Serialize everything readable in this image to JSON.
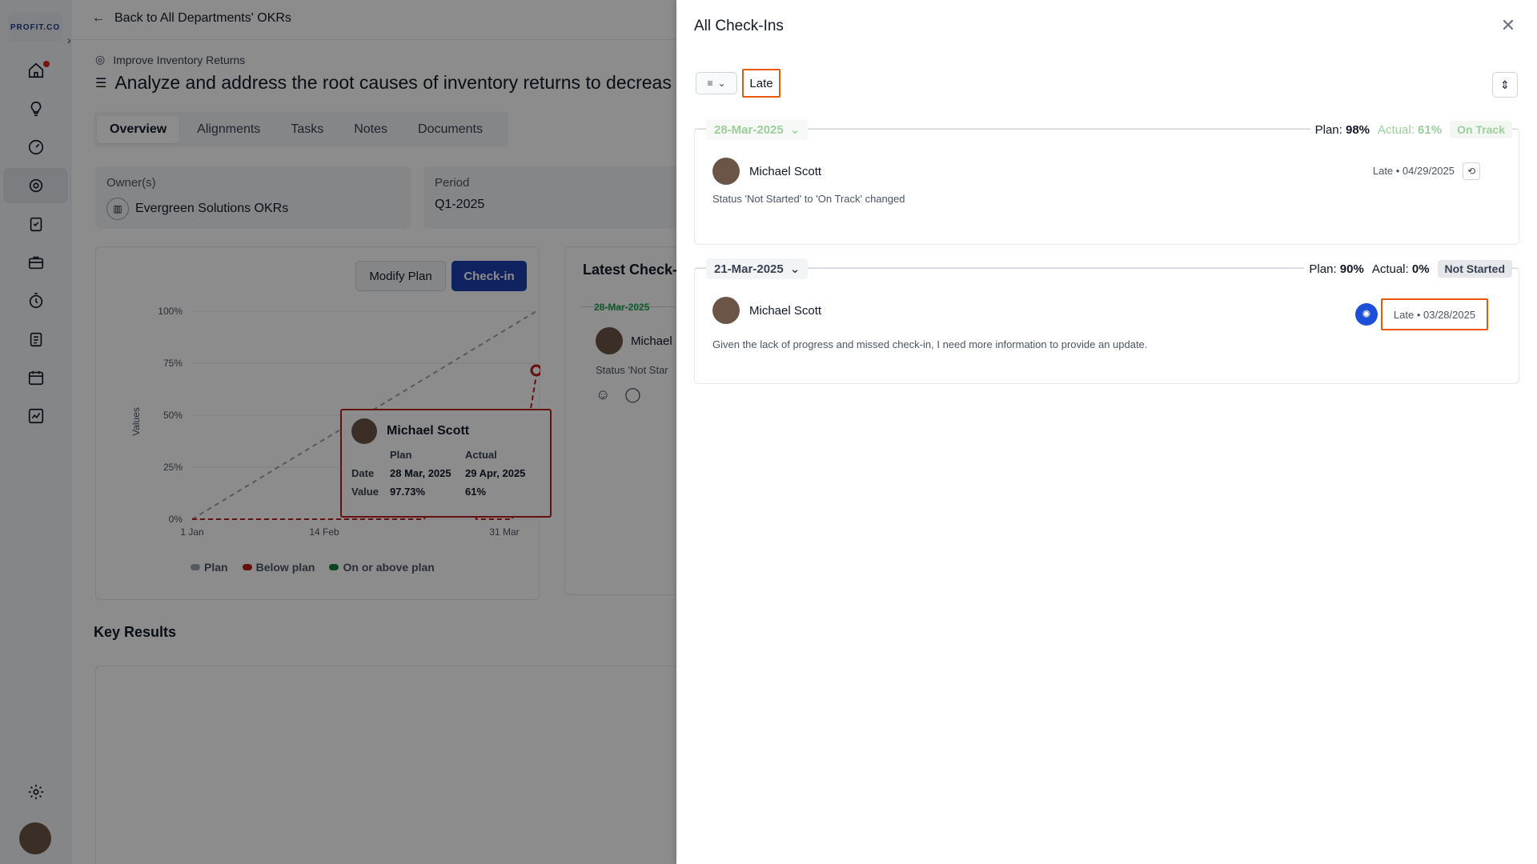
{
  "app": {
    "logo_text": "PROFIT.CO"
  },
  "main": {
    "back_label": "Back to All Departments' OKRs",
    "breadcrumb": "Improve Inventory Returns",
    "title": "Analyze and address the root causes of inventory returns to decreas",
    "tabs": [
      {
        "label": "Overview"
      },
      {
        "label": "Alignments"
      },
      {
        "label": "Tasks"
      },
      {
        "label": "Notes"
      },
      {
        "label": "Documents"
      }
    ],
    "owner_label": "Owner(s)",
    "owner_value": "Evergreen Solutions OKRs",
    "period_label": "Period",
    "period_value": "Q1-2025",
    "modify_plan_label": "Modify Plan",
    "checkin_label": "Check-in",
    "key_results_label": "Key Results",
    "latest": {
      "title": "Latest Check-",
      "date": "28-Mar-2025",
      "user": "Michael",
      "status": "Status 'Not Star"
    }
  },
  "chart_data": {
    "type": "line",
    "ylabel": "Values",
    "y_ticks": [
      "100%",
      "75%",
      "50%",
      "25%",
      "0%"
    ],
    "x_ticks": [
      "1 Jan",
      "14 Feb",
      "31 Mar"
    ],
    "ylim": [
      0,
      100
    ],
    "series": [
      {
        "name": "Plan",
        "color": "#9ca3af"
      },
      {
        "name": "Below plan",
        "color": "#b91c1c"
      },
      {
        "name": "On or above plan",
        "color": "#15803d"
      }
    ],
    "tooltip": {
      "user": "Michael Scott",
      "col_plan": "Plan",
      "col_actual": "Actual",
      "row_date": "Date",
      "row_value": "Value",
      "plan_date": "28 Mar, 2025",
      "actual_date": "29 Apr, 2025",
      "plan_value": "97.73%",
      "actual_value": "61%"
    }
  },
  "drawer": {
    "title": "All Check-Ins",
    "filter_chip": "Late",
    "entries": [
      {
        "date": "28-Mar-2025",
        "plan_label": "Plan:",
        "plan_value": "98%",
        "actual_label": "Actual:",
        "actual_value": "61%",
        "status": "On Track",
        "user": "Michael Scott",
        "late_text": "Late • 04/29/2025",
        "text": "Status 'Not Started' to 'On Track' changed"
      },
      {
        "date": "21-Mar-2025",
        "plan_label": "Plan:",
        "plan_value": "90%",
        "actual_label": "Actual:",
        "actual_value": "0%",
        "status": "Not Started",
        "user": "Michael Scott",
        "late_text": "Late • 03/28/2025",
        "text": "Given the lack of progress and missed check-in, I need more information to provide an update."
      }
    ]
  },
  "colors": {
    "accent": "#1e40af",
    "highlight": "#ea580c",
    "below_plan": "#b91c1c"
  }
}
